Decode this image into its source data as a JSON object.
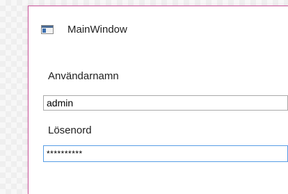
{
  "window": {
    "title": "MainWindow",
    "accent_border_color": "#c8579a",
    "icon": "app-window-icon"
  },
  "form": {
    "username": {
      "label": "Användarnamn",
      "value": "admin"
    },
    "password": {
      "label": "Lösenord",
      "value": "**********",
      "focused": true
    }
  }
}
